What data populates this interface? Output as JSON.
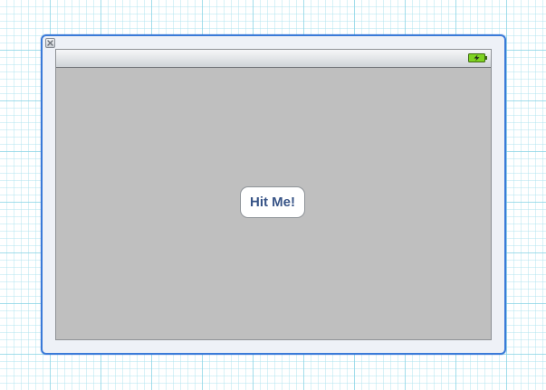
{
  "canvas": {
    "view_controller": {
      "close_icon": "close-icon",
      "status_bar": {
        "battery_icon": "battery-charging-icon",
        "battery_color": "#7ed321"
      },
      "main_view": {
        "background_color": "#bfbfbf",
        "button": {
          "label": "Hit Me!",
          "text_color": "#385487"
        }
      }
    }
  }
}
